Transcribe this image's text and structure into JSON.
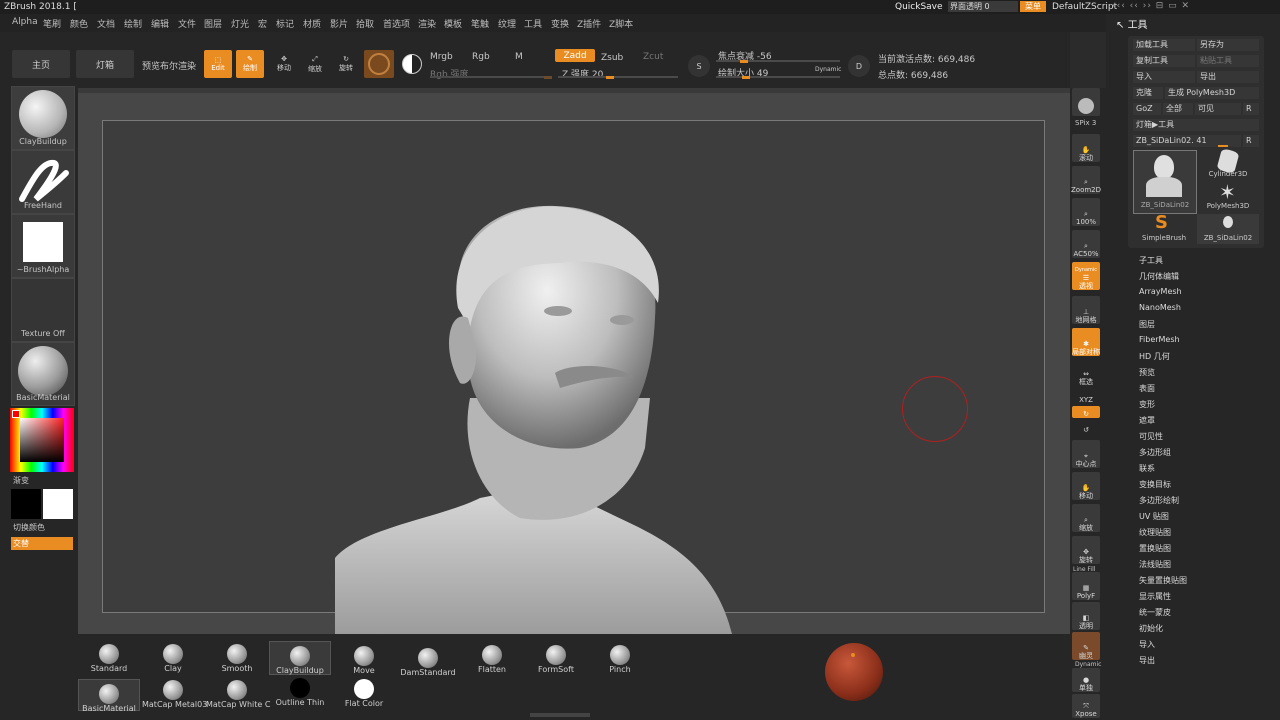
{
  "app": {
    "title": "ZBrush 2018.1 [",
    "quicksave": "QuickSave",
    "ui_transparency": "界面透明 0",
    "menu_btn": "菜单",
    "script": "DefaultZScript"
  },
  "menus": [
    "Alpha",
    "笔刷",
    "颜色",
    "文档",
    "绘制",
    "编辑",
    "文件",
    "图层",
    "灯光",
    "宏",
    "标记",
    "材质",
    "影片",
    "拾取",
    "首选项",
    "渲染",
    "模板",
    "笔触",
    "纹理",
    "工具",
    "变换",
    "Z插件",
    "Z脚本"
  ],
  "shelf": {
    "home": "主页",
    "lightbox": "灯箱",
    "preview_bool": "预览布尔渲染",
    "edit": "Edit",
    "draw": "绘制",
    "move": "移动",
    "scale": "缩放",
    "rotate": "旋转",
    "mrgb": "Mrgb",
    "rgb": "Rgb",
    "m": "M",
    "rgb_intensity": "Rgb 强度",
    "zadd": "Zadd",
    "zsub": "Zsub",
    "zcut": "Zcut",
    "z_intensity": "Z 强度 20",
    "focal_shift": "焦点衰减 -56",
    "draw_size": "绘制大小 49",
    "dynamic": "Dynamic",
    "active_points": "当前激活点数: 669,486",
    "total_points": "总点数: 669,486"
  },
  "left_tray": {
    "brush": "ClayBuildup",
    "stroke": "FreeHand",
    "alpha": "~BrushAlpha",
    "texture": "Texture Off",
    "material": "BasicMaterial",
    "gradient": "渐变",
    "switch_color": "切换颜色",
    "alternate": "交替"
  },
  "bottom_brushes": [
    "Standard",
    "Clay",
    "Smooth",
    "ClayBuildup",
    "Move",
    "DamStandard",
    "Flatten",
    "FormSoft",
    "Pinch"
  ],
  "bottom_materials": [
    "BasicMaterial",
    "MatCap Metal03",
    "MatCap White C",
    "Outline Thin",
    "Flat Color"
  ],
  "right_tools": {
    "bpr": "BPR",
    "spix": "SPix 3",
    "scroll": "滚动",
    "zoom2d": "Zoom2D",
    "actual": "100%",
    "ac50": "AC50%",
    "dynamic": "Dynamic",
    "persp": "透视",
    "floor": "地网格",
    "local": "局部对称",
    "xyz": "XYZ",
    "move": "移动",
    "scale": "缩放",
    "rotate": "旋转",
    "linefill": "Line Fill",
    "polyf": "PolyF",
    "transp": "透明",
    "ghost": "幽灵",
    "dynamic2": "Dynamic",
    "solo": "单独",
    "xpose": "Xpose",
    "frame": "框选",
    "center": "中心点"
  },
  "tool_panel": {
    "header": "工具",
    "load": "加载工具",
    "save_as": "另存为",
    "copy": "复制工具",
    "paste": "粘贴工具",
    "import": "导入",
    "export": "导出",
    "clone": "克隆",
    "make_polymesh": "生成 PolyMesh3D",
    "goz": "GoZ",
    "all": "全部",
    "visible": "可见",
    "r": "R",
    "lightbox_tools": "灯箱▶工具",
    "current_tool": "ZB_SiDaLin02. 41",
    "thumbs": [
      "ZB_SiDaLin02",
      "Cylinder3D",
      "PolyMesh3D",
      "SimpleBrush",
      "ZB_SiDaLin02"
    ],
    "subpalettes": [
      "子工具",
      "几何体编辑",
      "ArrayMesh",
      "NanoMesh",
      "图层",
      "FiberMesh",
      "HD 几何",
      "预览",
      "表面",
      "变形",
      "遮罩",
      "可见性",
      "多边形组",
      "联系",
      "变换目标",
      "多边形绘制",
      "UV 贴图",
      "纹理贴图",
      "置换贴图",
      "法线贴图",
      "矢量置换贴图",
      "显示属性",
      "统一蒙皮",
      "初始化",
      "导入",
      "导出"
    ]
  },
  "colors": {
    "accent": "#e98d22",
    "canvas": "#474747",
    "panel": "#262626"
  }
}
